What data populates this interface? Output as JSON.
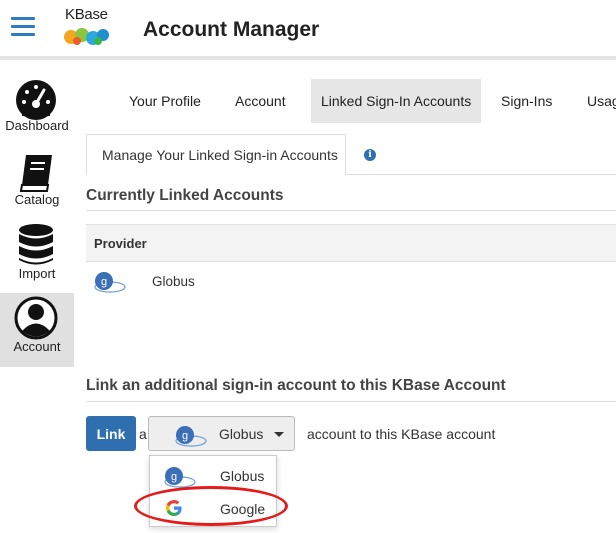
{
  "header": {
    "logo_text": "KBase",
    "title": "Account Manager",
    "menu_icon": "hamburger-icon"
  },
  "sidebar": {
    "items": [
      {
        "label": "Dashboard",
        "icon": "dashboard-icon",
        "active": false
      },
      {
        "label": "Catalog",
        "icon": "book-icon",
        "active": false
      },
      {
        "label": "Import",
        "icon": "database-icon",
        "active": false
      },
      {
        "label": "Account",
        "icon": "user-circle-icon",
        "active": true
      }
    ]
  },
  "tabs": [
    {
      "label": "Your Profile",
      "active": false
    },
    {
      "label": "Account",
      "active": false
    },
    {
      "label": "Linked Sign-In Accounts",
      "active": true
    },
    {
      "label": "Sign-Ins",
      "active": false
    },
    {
      "label": "Usag",
      "active": false
    }
  ],
  "subtab": {
    "label": "Manage Your Linked Sign-in Accounts",
    "info_icon": "info-icon",
    "info_glyph": "i"
  },
  "linked": {
    "title": "Currently Linked Accounts",
    "column_provider": "Provider",
    "rows": [
      {
        "provider": "Globus",
        "icon": "globus-icon"
      }
    ]
  },
  "link_section": {
    "title": "Link an additional sign-in account to this KBase Account",
    "button_label": "Link",
    "article": "a",
    "selected_provider": "Globus",
    "suffix": "account to this KBase account",
    "options": [
      "Globus",
      "Google"
    ]
  },
  "colors": {
    "accent": "#2f6fb0",
    "highlight": "#e31b1b"
  }
}
